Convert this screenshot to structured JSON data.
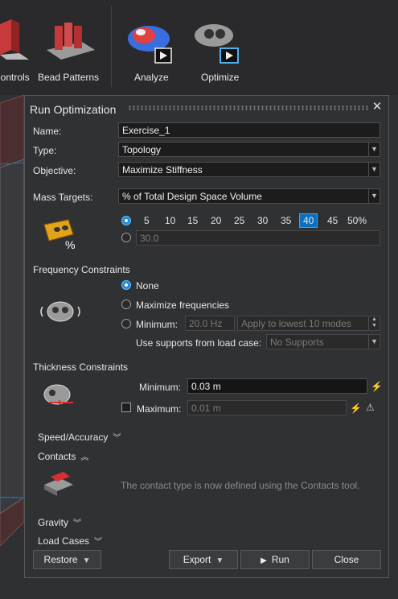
{
  "toolbar": {
    "items": [
      {
        "label": "Controls",
        "icon": "shape-controls-icon"
      },
      {
        "label": "Bead Patterns",
        "icon": "bead-patterns-icon"
      },
      {
        "label": "Analyze",
        "icon": "analyze-icon"
      },
      {
        "label": "Optimize",
        "icon": "optimize-icon"
      }
    ]
  },
  "dialog": {
    "title": "Run Optimization",
    "name_label": "Name:",
    "name_value": "Exercise_1",
    "type_label": "Type:",
    "type_value": "Topology",
    "objective_label": "Objective:",
    "objective_value": "Maximize Stiffness",
    "mass_targets_label": "Mass Targets:",
    "mass_targets_value": "% of Total Design Space Volume",
    "percent_options": [
      "5",
      "10",
      "15",
      "20",
      "25",
      "30",
      "35",
      "40",
      "45",
      "50%"
    ],
    "percent_selected": "40",
    "custom_value": "30.0",
    "frequency": {
      "heading": "Frequency Constraints",
      "none": "None",
      "maximize": "Maximize frequencies",
      "minimum": "Minimum:",
      "minimum_value": "20.0 Hz",
      "modes_value": "Apply to lowest 10 modes",
      "supports_label": "Use supports from load case:",
      "supports_value": "No Supports"
    },
    "thickness": {
      "heading": "Thickness Constraints",
      "minimum_label": "Minimum:",
      "minimum_value": "0.03 m",
      "maximum_label": "Maximum:",
      "maximum_value": "0.01 m"
    },
    "speed_accuracy": "Speed/Accuracy",
    "contacts": "Contacts",
    "contacts_note": "The contact type is now defined using the Contacts tool.",
    "gravity": "Gravity",
    "load_cases": "Load Cases",
    "buttons": {
      "restore": "Restore",
      "export": "Export",
      "run": "Run",
      "close": "Close"
    }
  }
}
